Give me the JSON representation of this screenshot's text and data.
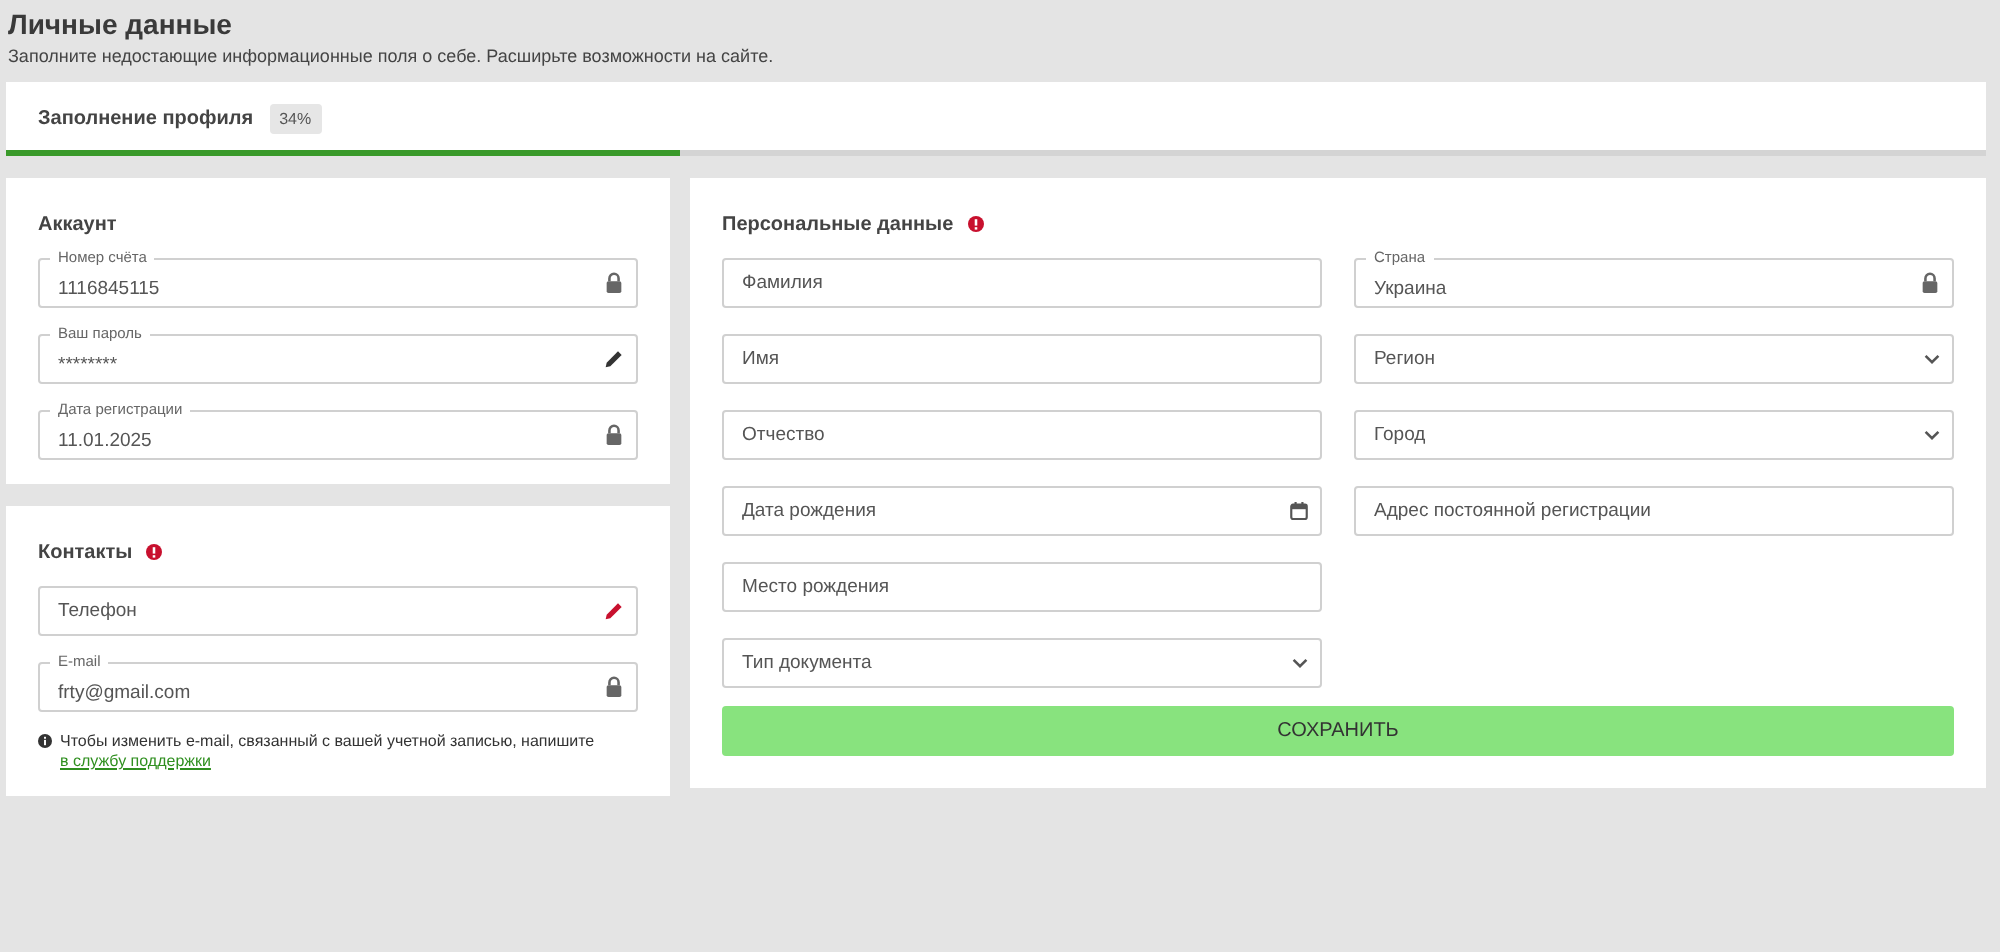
{
  "page": {
    "title": "Личные данные",
    "subtitle": "Заполните недостающие информационные поля о себе. Расширьте возможности на сайте."
  },
  "progress": {
    "label": "Заполнение профиля",
    "badge": "34%",
    "level": 0.34
  },
  "account": {
    "title": "Аккаунт",
    "fields": [
      {
        "kind": "lock",
        "label": "Номер счёта",
        "value": "1116845115"
      },
      {
        "kind": "edit",
        "label": "Ваш пароль",
        "value": "********",
        "warning": false
      },
      {
        "kind": "lock",
        "label": "Дата регистрации",
        "value": "11.01.2025"
      }
    ]
  },
  "contacts": {
    "title": "Контакты",
    "warning": true,
    "fields": [
      {
        "kind": "edit",
        "placeholder": "Телефон",
        "warning": true
      },
      {
        "kind": "lock",
        "label": "E-mail",
        "value": "frty@gmail.com"
      }
    ],
    "note": {
      "text": "Чтобы изменить e-mail, связанный с вашей учетной записью, напишите",
      "link": "в службу поддержки"
    }
  },
  "personal": {
    "title": "Персональные данные",
    "warning": true,
    "columns": [
      [
        {
          "kind": "text",
          "placeholder": "Фамилия"
        },
        {
          "kind": "text",
          "placeholder": "Имя"
        },
        {
          "kind": "text",
          "placeholder": "Отчество"
        },
        {
          "kind": "date",
          "placeholder": "Дата рождения"
        },
        {
          "kind": "text",
          "placeholder": "Место рождения"
        },
        {
          "kind": "select",
          "placeholder": "Тип документа"
        }
      ],
      [
        {
          "kind": "lock",
          "label": "Страна",
          "value": "Украина"
        },
        {
          "kind": "select",
          "placeholder": "Регион"
        },
        {
          "kind": "select",
          "placeholder": "Город"
        },
        {
          "kind": "text",
          "placeholder": "Адрес постоянной регистрации"
        }
      ]
    ],
    "save": "СОХРАНИТЬ"
  }
}
